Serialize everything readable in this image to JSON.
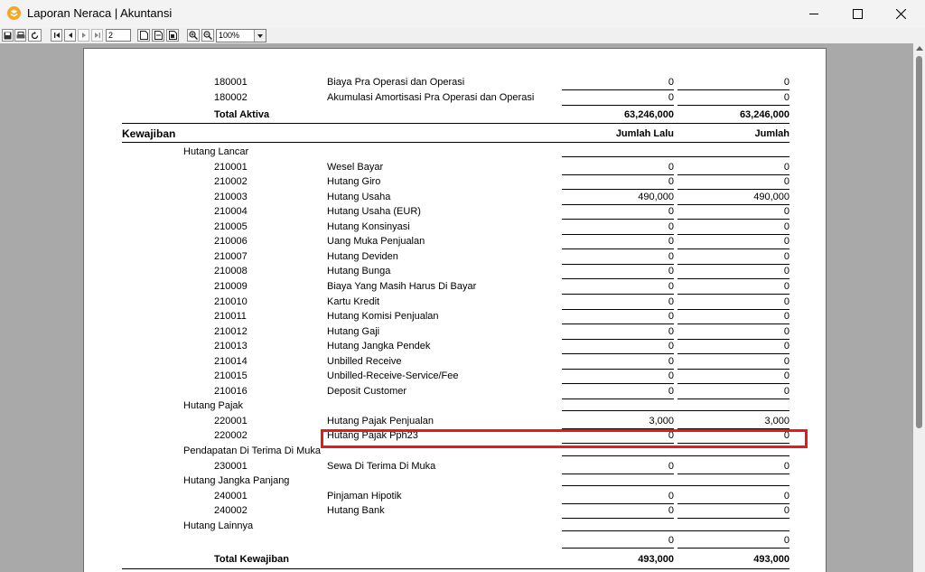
{
  "window": {
    "title": "Laporan Neraca | Akuntansi"
  },
  "toolbar": {
    "page_number": "2",
    "zoom": "100%"
  },
  "report": {
    "top_rows": [
      {
        "code": "180001",
        "name": "Biaya Pra Operasi dan Operasi",
        "prev": "0",
        "curr": "0"
      },
      {
        "code": "180002",
        "name": "Akumulasi Amortisasi Pra Operasi dan Operasi",
        "prev": "0",
        "curr": "0"
      }
    ],
    "total_aktiva": {
      "label": "Total Aktiva",
      "prev": "63,246,000",
      "curr": "63,246,000"
    },
    "kewajiban_header": {
      "label": "Kewajiban",
      "col_prev": "Jumlah Lalu",
      "col_curr": "Jumlah"
    },
    "groups": [
      {
        "name": "Hutang Lancar",
        "rows": [
          {
            "code": "210001",
            "name": "Wesel Bayar",
            "prev": "0",
            "curr": "0"
          },
          {
            "code": "210002",
            "name": "Hutang Giro",
            "prev": "0",
            "curr": "0"
          },
          {
            "code": "210003",
            "name": "Hutang Usaha",
            "prev": "490,000",
            "curr": "490,000"
          },
          {
            "code": "210004",
            "name": "Hutang Usaha (EUR)",
            "prev": "0",
            "curr": "0"
          },
          {
            "code": "210005",
            "name": "Hutang Konsinyasi",
            "prev": "0",
            "curr": "0"
          },
          {
            "code": "210006",
            "name": "Uang Muka Penjualan",
            "prev": "0",
            "curr": "0"
          },
          {
            "code": "210007",
            "name": "Hutang Deviden",
            "prev": "0",
            "curr": "0"
          },
          {
            "code": "210008",
            "name": "Hutang Bunga",
            "prev": "0",
            "curr": "0"
          },
          {
            "code": "210009",
            "name": "Biaya Yang Masih Harus Di Bayar",
            "prev": "0",
            "curr": "0"
          },
          {
            "code": "210010",
            "name": "Kartu Kredit",
            "prev": "0",
            "curr": "0"
          },
          {
            "code": "210011",
            "name": "Hutang Komisi Penjualan",
            "prev": "0",
            "curr": "0"
          },
          {
            "code": "210012",
            "name": "Hutang Gaji",
            "prev": "0",
            "curr": "0"
          },
          {
            "code": "210013",
            "name": "Hutang Jangka Pendek",
            "prev": "0",
            "curr": "0"
          },
          {
            "code": "210014",
            "name": "Unbilled Receive",
            "prev": "0",
            "curr": "0"
          },
          {
            "code": "210015",
            "name": "Unbilled-Receive-Service/Fee",
            "prev": "0",
            "curr": "0"
          },
          {
            "code": "210016",
            "name": "Deposit Customer",
            "prev": "0",
            "curr": "0"
          }
        ]
      },
      {
        "name": "Hutang Pajak",
        "rows": [
          {
            "code": "220001",
            "name": "Hutang Pajak Penjualan",
            "prev": "3,000",
            "curr": "3,000"
          },
          {
            "code": "220002",
            "name": "Hutang Pajak Pph23",
            "prev": "0",
            "curr": "0"
          }
        ]
      },
      {
        "name": "Pendapatan Di Terima Di Muka",
        "rows": [
          {
            "code": "230001",
            "name": "Sewa Di Terima Di Muka",
            "prev": "0",
            "curr": "0"
          }
        ]
      },
      {
        "name": "Hutang Jangka Panjang",
        "rows": [
          {
            "code": "240001",
            "name": "Pinjaman Hipotik",
            "prev": "0",
            "curr": "0"
          },
          {
            "code": "240002",
            "name": "Hutang Bank",
            "prev": "0",
            "curr": "0"
          }
        ]
      },
      {
        "name": "Hutang Lainnya",
        "rows": [
          {
            "code": "",
            "name": "",
            "prev": "0",
            "curr": "0"
          }
        ]
      }
    ],
    "total_kewajiban": {
      "label": "Total Kewajiban",
      "prev": "493,000",
      "curr": "493,000"
    }
  }
}
